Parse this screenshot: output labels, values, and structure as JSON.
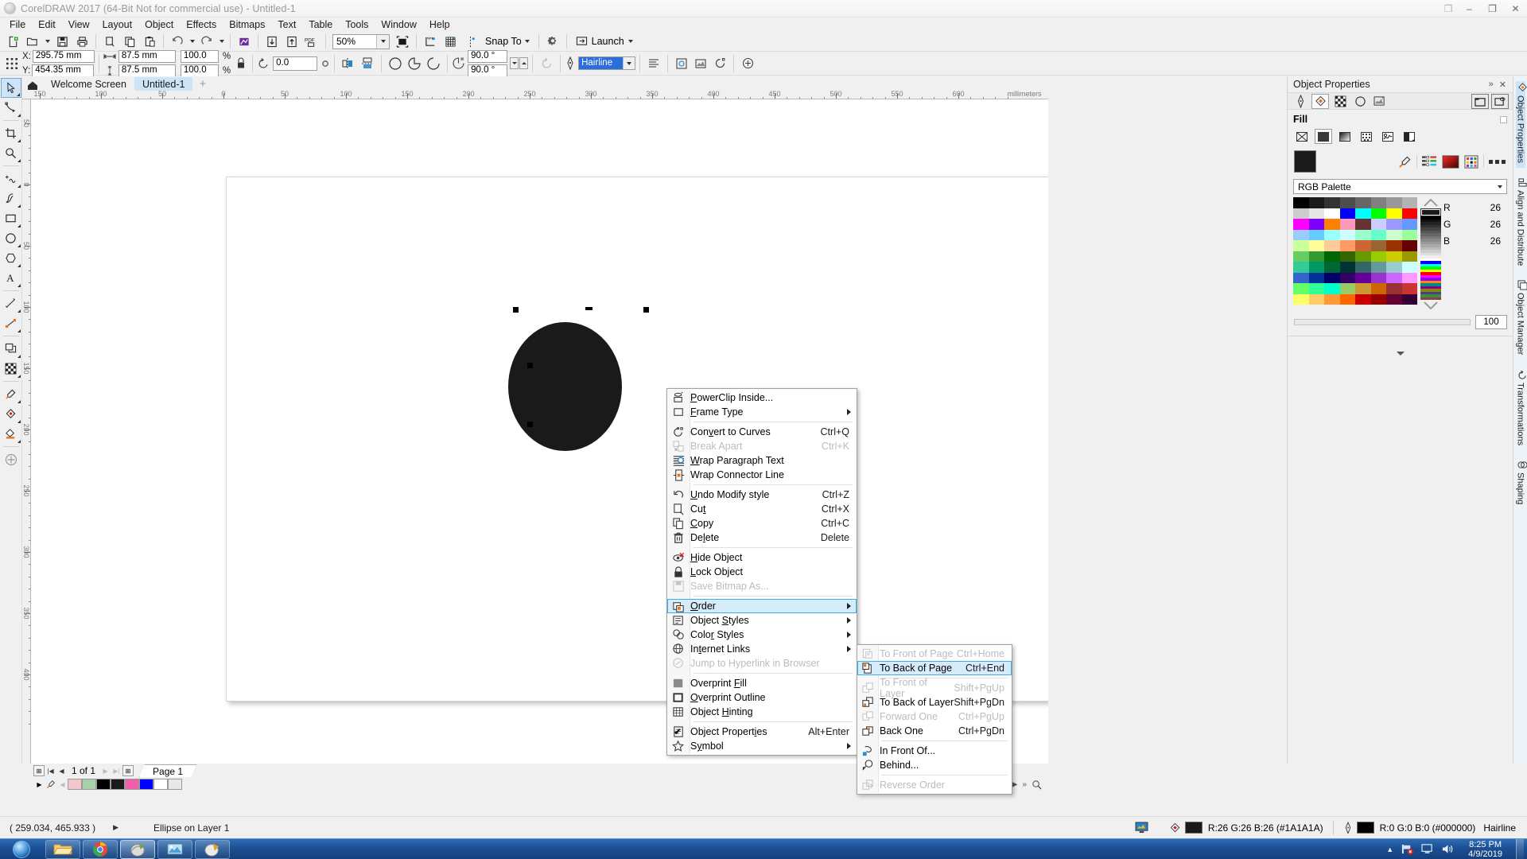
{
  "window": {
    "title": "CorelDRAW 2017 (64-Bit Not for commercial use) - Untitled-1",
    "minimize": "–",
    "maximize": "❐",
    "restore": "❒",
    "close": "✕"
  },
  "menubar": [
    {
      "label": "File"
    },
    {
      "label": "Edit"
    },
    {
      "label": "View"
    },
    {
      "label": "Layout"
    },
    {
      "label": "Object"
    },
    {
      "label": "Effects"
    },
    {
      "label": "Bitmaps"
    },
    {
      "label": "Text"
    },
    {
      "label": "Table"
    },
    {
      "label": "Tools"
    },
    {
      "label": "Window"
    },
    {
      "label": "Help"
    }
  ],
  "toolbar": {
    "zoom_level": "50%",
    "snap_to": "Snap To",
    "launch": "Launch",
    "icons": [
      "new-document-icon",
      "open-document-icon",
      "save-icon",
      "print-icon",
      "cut-icon",
      "copy-icon",
      "paste-icon",
      "undo-icon",
      "redo-icon",
      "publish-icon",
      "import-icon",
      "export-icon",
      "export-pdf-icon",
      "zoom-combo",
      "full-screen-preview-icon",
      "show-rulers-icon",
      "show-grid-icon",
      "show-guides-icon",
      "options-icon"
    ]
  },
  "propertybar": {
    "x_label": "X:",
    "x_value": "295.75 mm",
    "y_label": "Y:",
    "y_value": "454.35 mm",
    "width_value": "87.5 mm",
    "height_value": "87.5 mm",
    "scale_w": "100.0",
    "scale_h": "100.0",
    "percent": "%",
    "rotation": "0.0",
    "arc_start": "90.0 °",
    "arc_end": "90.0 °",
    "outline_width": "Hairline"
  },
  "document_tabs": [
    {
      "label": "Welcome Screen",
      "active": false,
      "icon": "home-icon"
    },
    {
      "label": "Untitled-1",
      "active": true
    },
    {
      "label": "+",
      "active": false
    }
  ],
  "rulers": {
    "unit": "millimeters",
    "h_labels": [
      "150",
      "100",
      "50",
      "0",
      "50",
      "100",
      "150",
      "200",
      "250",
      "300",
      "350",
      "400",
      "450",
      "500",
      "550",
      "600"
    ],
    "v_labels": [
      "50",
      "0",
      "50",
      "100",
      "150",
      "200",
      "250",
      "300",
      "350",
      "400"
    ]
  },
  "toolbox": [
    {
      "name": "pick-tool",
      "icon": "arrow"
    },
    {
      "name": "shape-tool",
      "icon": "node"
    },
    {
      "name": "crop-tool",
      "icon": "crop"
    },
    {
      "name": "zoom-tool",
      "icon": "magnifier"
    },
    {
      "name": "freehand-tool",
      "icon": "freehand"
    },
    {
      "name": "artistic-media-tool",
      "icon": "brush"
    },
    {
      "name": "rectangle-tool",
      "icon": "rect"
    },
    {
      "name": "ellipse-tool",
      "icon": "ellipse"
    },
    {
      "name": "polygon-tool",
      "icon": "polygon"
    },
    {
      "name": "text-tool",
      "icon": "letter-a"
    },
    {
      "name": "parallel-dimension-tool",
      "icon": "dimension"
    },
    {
      "name": "straight-line-connector-tool",
      "icon": "connector"
    },
    {
      "name": "drop-shadow-tool",
      "icon": "shadow"
    },
    {
      "name": "transparency-tool",
      "icon": "checker"
    },
    {
      "name": "color-eyedropper-tool",
      "icon": "eyedropper"
    },
    {
      "name": "outline-tool",
      "icon": "pen-nib"
    },
    {
      "name": "fill-tool",
      "icon": "fill-bucket"
    },
    {
      "name": "interactive-fill-tool",
      "icon": "circle-plus"
    }
  ],
  "canvas": {
    "object": "ellipse",
    "fill_hex": "#1A1A1A"
  },
  "context_menu": {
    "groups": [
      {
        "items": [
          {
            "label": "PowerClip Inside...",
            "shortcut": "",
            "icon": "powerclip-icon",
            "disabled": false,
            "submenu": false,
            "underline": "P"
          },
          {
            "label": "Frame Type",
            "shortcut": "",
            "icon": "frame-type-icon",
            "disabled": false,
            "submenu": true,
            "underline": "F"
          }
        ]
      },
      {
        "items": [
          {
            "label": "Convert to Curves",
            "shortcut": "Ctrl+Q",
            "icon": "convert-to-curves-icon",
            "disabled": false,
            "submenu": false,
            "underline": "v"
          },
          {
            "label": "Break Apart",
            "shortcut": "Ctrl+K",
            "icon": "break-apart-icon",
            "disabled": true,
            "submenu": false,
            "underline": ""
          },
          {
            "label": "Wrap Paragraph Text",
            "shortcut": "",
            "icon": "wrap-paragraph-text-icon",
            "disabled": false,
            "submenu": false,
            "underline": "W"
          },
          {
            "label": "Wrap Connector Line",
            "shortcut": "",
            "icon": "wrap-connector-line-icon",
            "disabled": false,
            "submenu": false,
            "underline": ""
          }
        ]
      },
      {
        "items": [
          {
            "label": "Undo Modify style",
            "shortcut": "Ctrl+Z",
            "icon": "undo-icon",
            "disabled": false,
            "submenu": false,
            "underline": "U"
          },
          {
            "label": "Cut",
            "shortcut": "Ctrl+X",
            "icon": "cut-icon",
            "disabled": false,
            "submenu": false,
            "underline": "t"
          },
          {
            "label": "Copy",
            "shortcut": "Ctrl+C",
            "icon": "copy-icon",
            "disabled": false,
            "submenu": false,
            "underline": "C"
          },
          {
            "label": "Delete",
            "shortcut": "Delete",
            "icon": "delete-icon",
            "disabled": false,
            "submenu": false,
            "underline": "l"
          }
        ]
      },
      {
        "items": [
          {
            "label": "Hide Object",
            "shortcut": "",
            "icon": "hide-object-icon",
            "disabled": false,
            "submenu": false,
            "underline": "H"
          },
          {
            "label": "Lock Object",
            "shortcut": "",
            "icon": "lock-object-icon",
            "disabled": false,
            "submenu": false,
            "underline": "L"
          },
          {
            "label": "Save Bitmap As...",
            "shortcut": "",
            "icon": "save-bitmap-icon",
            "disabled": true,
            "submenu": false,
            "underline": ""
          }
        ]
      },
      {
        "items": [
          {
            "label": "Order",
            "shortcut": "",
            "icon": "order-icon",
            "disabled": false,
            "submenu": true,
            "highlighted": true,
            "underline": "O"
          },
          {
            "label": "Object Styles",
            "shortcut": "",
            "icon": "object-styles-icon",
            "disabled": false,
            "submenu": true,
            "underline": "S"
          },
          {
            "label": "Color Styles",
            "shortcut": "",
            "icon": "color-styles-icon",
            "disabled": false,
            "submenu": true,
            "underline": "r"
          },
          {
            "label": "Internet Links",
            "shortcut": "",
            "icon": "internet-links-icon",
            "disabled": false,
            "submenu": true,
            "underline": "t"
          },
          {
            "label": "Jump to Hyperlink in Browser",
            "shortcut": "",
            "icon": "jump-hyperlink-icon",
            "disabled": true,
            "submenu": false,
            "underline": ""
          }
        ]
      },
      {
        "items": [
          {
            "label": "Overprint Fill",
            "shortcut": "",
            "icon": "overprint-fill-icon",
            "disabled": false,
            "submenu": false,
            "underline": "F"
          },
          {
            "label": "Overprint Outline",
            "shortcut": "",
            "icon": "overprint-outline-icon",
            "disabled": false,
            "submenu": false,
            "underline": "O"
          },
          {
            "label": "Object Hinting",
            "shortcut": "",
            "icon": "object-hinting-icon",
            "disabled": false,
            "submenu": false,
            "underline": "H"
          }
        ]
      },
      {
        "items": [
          {
            "label": "Object Properties",
            "shortcut": "Alt+Enter",
            "icon": "object-properties-icon",
            "disabled": false,
            "submenu": false,
            "checked": true,
            "underline": "i"
          },
          {
            "label": "Symbol",
            "shortcut": "",
            "icon": "symbol-icon",
            "disabled": false,
            "submenu": true,
            "underline": "y"
          }
        ]
      }
    ]
  },
  "order_submenu": {
    "groups": [
      {
        "items": [
          {
            "label": "To Front of Page",
            "shortcut": "Ctrl+Home",
            "icon": "to-front-of-page-icon",
            "disabled": true
          },
          {
            "label": "To Back of Page",
            "shortcut": "Ctrl+End",
            "icon": "to-back-of-page-icon",
            "disabled": false,
            "highlighted": true
          }
        ]
      },
      {
        "items": [
          {
            "label": "To Front of Layer",
            "shortcut": "Shift+PgUp",
            "icon": "to-front-of-layer-icon",
            "disabled": true
          },
          {
            "label": "To Back of Layer",
            "shortcut": "Shift+PgDn",
            "icon": "to-back-of-layer-icon",
            "disabled": false
          },
          {
            "label": "Forward One",
            "shortcut": "Ctrl+PgUp",
            "icon": "forward-one-icon",
            "disabled": true
          },
          {
            "label": "Back One",
            "shortcut": "Ctrl+PgDn",
            "icon": "back-one-icon",
            "disabled": false
          }
        ]
      },
      {
        "items": [
          {
            "label": "In Front Of...",
            "shortcut": "",
            "icon": "in-front-of-icon",
            "disabled": false
          },
          {
            "label": "Behind...",
            "shortcut": "",
            "icon": "behind-icon",
            "disabled": false
          }
        ]
      },
      {
        "items": [
          {
            "label": "Reverse Order",
            "shortcut": "",
            "icon": "reverse-order-icon",
            "disabled": true
          }
        ]
      }
    ]
  },
  "docker": {
    "title": "Object Properties",
    "collapse_icon": "»",
    "close_icon": "✕",
    "tabs": [
      "outline-pen-tab",
      "fill-tab",
      "transparency-tab",
      "shape-tab",
      "bitmap-tab"
    ],
    "section_fill": "Fill",
    "fill_types": [
      "no-fill-icon",
      "uniform-fill-icon",
      "fountain-fill-icon",
      "vector-pattern-icon",
      "bitmap-pattern-icon",
      "two-color-pattern-icon"
    ],
    "palette_name": "RGB Palette",
    "rgb": {
      "r_label": "R",
      "r": "26",
      "g_label": "G",
      "g": "26",
      "b_label": "B",
      "b": "26"
    },
    "opacity": "100"
  },
  "rail": [
    {
      "label": "Object Properties",
      "selected": true
    },
    {
      "label": "Align and Distribute",
      "selected": false
    },
    {
      "label": "Object Manager",
      "selected": false
    },
    {
      "label": "Transformations",
      "selected": false
    },
    {
      "label": "Shaping",
      "selected": false
    }
  ],
  "pagenav": {
    "count": "1 of 1",
    "page_tab": "Page 1",
    "first": "|◀",
    "prev": "◀",
    "next": "▶",
    "last": "▶|",
    "add": "⊞"
  },
  "palette_strip": [
    "#f0c8cc",
    "#a8d0a8",
    "#000000",
    "#1a1a1a",
    "#f060a8",
    "#0000ff",
    "#ffffff",
    "#e8e8e8"
  ],
  "statusbar": {
    "coordinates": "( 259.034, 465.933 )",
    "object_info": "Ellipse on Layer 1",
    "fill_text": "R:26 G:26 B:26 (#1A1A1A)",
    "fill_color": "#1A1A1A",
    "outline_text": "R:0 G:0 B:0 (#000000)",
    "outline_color": "#000000",
    "outline_width": "Hairline"
  },
  "taskbar": {
    "items": [
      "file-explorer-icon",
      "chrome-icon",
      "coreldraw-icon",
      "photo-paint-icon",
      "capture-icon"
    ],
    "tray": [
      "show-hidden-icon",
      "network-error-icon",
      "display-icon",
      "volume-icon"
    ],
    "time": "8:25 PM",
    "date": "4/9/2019"
  }
}
